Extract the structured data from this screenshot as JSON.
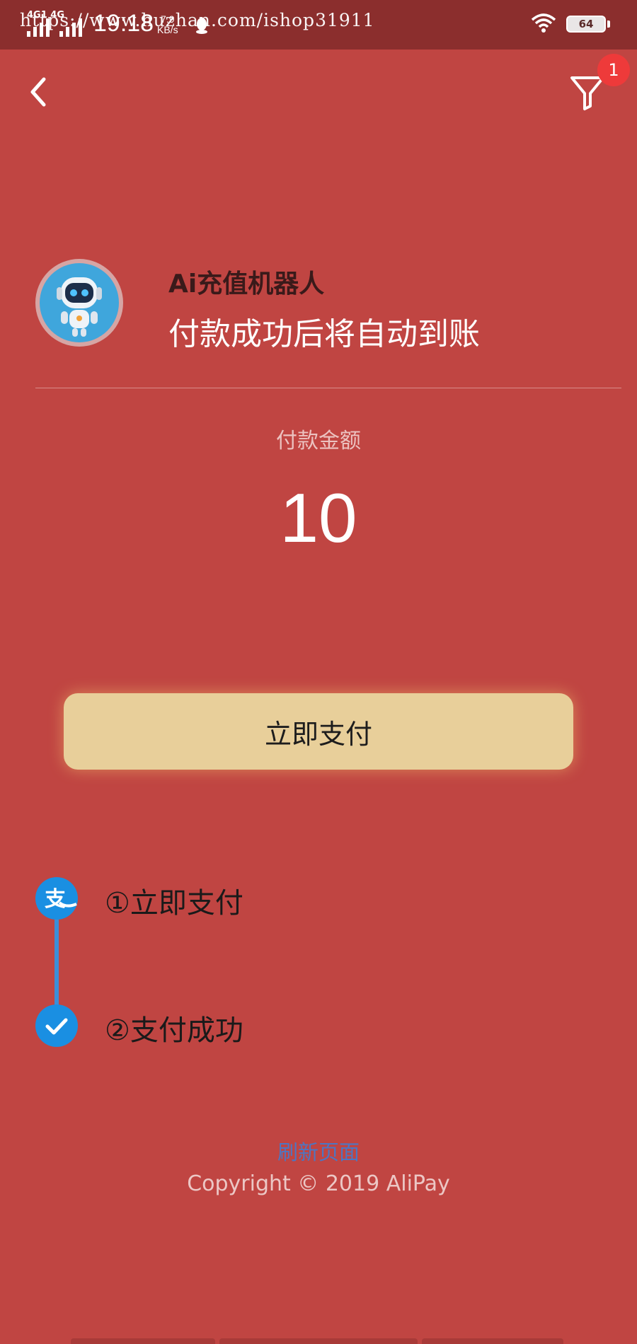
{
  "status_bar": {
    "network": "4G1 4G",
    "time": "19:18",
    "speed_value": "7.9",
    "speed_unit": "KB/s",
    "battery": "64",
    "watermark": "https://www.huzhan.com/ishop31911"
  },
  "header": {
    "back_icon": "chevron-left-icon",
    "filter_icon": "filter-icon",
    "badge_count": "1"
  },
  "merchant": {
    "avatar_icon": "robot-avatar",
    "name": "Ai充值机器人",
    "note": "付款成功后将自动到账"
  },
  "payment": {
    "amount_label": "付款金额",
    "amount": "10",
    "pay_button": "立即支付"
  },
  "steps": [
    {
      "icon": "alipay-icon",
      "label": "①立即支付"
    },
    {
      "icon": "check-icon",
      "label": "②支付成功"
    }
  ],
  "footer": {
    "refresh_link": "刷新页面",
    "copyright": "Copyright © 2019 AliPay"
  },
  "colors": {
    "background": "#c04542",
    "status_bar": "#8b2e2d",
    "pay_button": "#e8cf9a",
    "step_blue": "#1a8fe2",
    "link": "#4d76c2",
    "badge": "#ee3a3a"
  }
}
